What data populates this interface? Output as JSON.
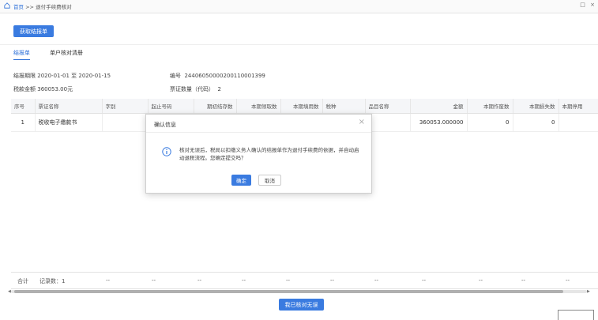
{
  "breadcrumb": {
    "home": "首页",
    "separator": ">>",
    "current": "退付手续费核对"
  },
  "window_controls": {
    "restore": "□",
    "close": "×"
  },
  "toolbar": {
    "fetch_label": "获取结报单"
  },
  "tabs": [
    {
      "label": "结报单",
      "active": true
    },
    {
      "label": "单户核对清册",
      "active": false
    }
  ],
  "info": {
    "period_label": "结报期限",
    "period_value": "2020-01-01  至  2020-01-15",
    "number_label": "编号",
    "number_value": "244060500002001100013​99",
    "amount_label": "税款金额",
    "amount_value": "360053.00元",
    "ticket_count_label": "票证数量（代码）",
    "ticket_count_value": "2"
  },
  "table": {
    "headers": [
      "序号",
      "票证名称",
      "字别",
      "起止号码",
      "期初结存数",
      "本期领取数",
      "本期填用数",
      "税种",
      "品目名称",
      "金额",
      "本期作废数",
      "本期损失数",
      "本期停用"
    ],
    "rows": [
      [
        "1",
        "税收电子缴款书",
        "",
        "",
        "",
        "",
        "",
        "",
        "",
        "360053.000000",
        "0",
        "0",
        ""
      ]
    ]
  },
  "totals": {
    "label": "合计",
    "record_count": "记录数：1",
    "dash": "--"
  },
  "modal": {
    "title": "确认信息",
    "close": "×",
    "message": "核对无误后，税局以扣缴义务人确认的结报单作为退付手续费的依据，并自动启动退税流程。您确定提交吗？",
    "ok_label": "确定",
    "cancel_label": "取消"
  },
  "bottom": {
    "checked_label": "我已核对无误"
  },
  "colors": {
    "primary": "#3a7be0",
    "link": "#2b6fd8"
  }
}
